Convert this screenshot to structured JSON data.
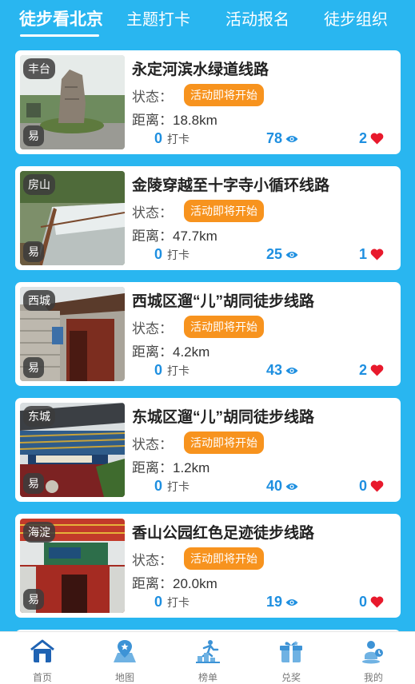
{
  "top_tabs": [
    "徒步看北京",
    "主题打卡",
    "活动报名",
    "徒步组织"
  ],
  "status_label": "状态：",
  "distance_label": "距离：",
  "checkin_unit": "打卡",
  "routes": [
    {
      "district": "丰台",
      "difficulty": "易",
      "title": "永定河滨水绿道线路",
      "status": "活动即将开始",
      "distance": "18.8km",
      "checkins": "0",
      "views": "78",
      "likes": "2"
    },
    {
      "district": "房山",
      "difficulty": "易",
      "title": "金陵穿越至十字寺小循环线路",
      "status": "活动即将开始",
      "distance": "47.7km",
      "checkins": "0",
      "views": "25",
      "likes": "1"
    },
    {
      "district": "西城",
      "difficulty": "易",
      "title": "西城区遛“儿”胡同徒步线路",
      "status": "活动即将开始",
      "distance": "4.2km",
      "checkins": "0",
      "views": "43",
      "likes": "2"
    },
    {
      "district": "东城",
      "difficulty": "易",
      "title": "东城区遛“儿”胡同徒步线路",
      "status": "活动即将开始",
      "distance": "1.2km",
      "checkins": "0",
      "views": "40",
      "likes": "0"
    },
    {
      "district": "海淀",
      "difficulty": "易",
      "title": "香山公园红色足迹徒步线路",
      "status": "活动即将开始",
      "distance": "20.0km",
      "checkins": "0",
      "views": "19",
      "likes": "0"
    }
  ],
  "bottom_nav": [
    {
      "label": "首页",
      "icon": "home-icon",
      "active": true
    },
    {
      "label": "地图",
      "icon": "map-icon",
      "active": false
    },
    {
      "label": "榜单",
      "icon": "ranking-icon",
      "active": false
    },
    {
      "label": "兑奖",
      "icon": "gift-icon",
      "active": false
    },
    {
      "label": "我的",
      "icon": "profile-icon",
      "active": false
    }
  ],
  "colors": {
    "background": "#29b6f0",
    "accent_blue": "#1e8fe0",
    "status_orange": "#f7931e",
    "heart_red": "#e8192c"
  }
}
